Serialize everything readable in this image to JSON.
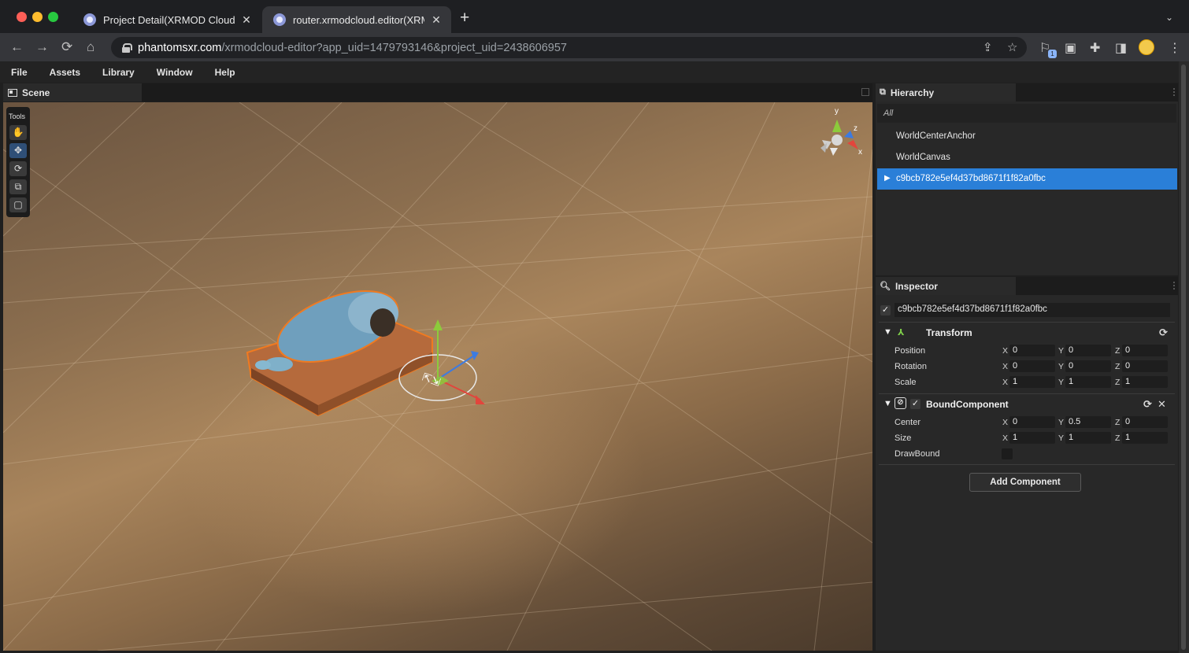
{
  "browser": {
    "tabs": [
      {
        "title": "Project Detail(XRMOD Cloud) -",
        "active": false
      },
      {
        "title": "router.xrmodcloud.editor(XRM",
        "active": true
      }
    ],
    "url_host": "phantomsxr.com",
    "url_path": "/xrmodcloud-editor?app_uid=1479793146&project_uid=2438606957",
    "extension_badge": "1"
  },
  "menu": [
    "File",
    "Assets",
    "Library",
    "Window",
    "Help"
  ],
  "scene": {
    "tab_label": "Scene",
    "tools_label": "Tools",
    "gizmo_labels": {
      "x": "x",
      "y": "y",
      "z": "z"
    },
    "tools": [
      {
        "name": "hand-icon",
        "glyph": "✋",
        "active": false
      },
      {
        "name": "move-icon",
        "glyph": "✥",
        "active": true
      },
      {
        "name": "rotate-icon",
        "glyph": "⟳",
        "active": false
      },
      {
        "name": "scale-icon",
        "glyph": "⧉",
        "active": false
      },
      {
        "name": "rect-icon",
        "glyph": "▢",
        "active": false
      }
    ]
  },
  "hierarchy": {
    "title": "Hierarchy",
    "filter": "All",
    "items": [
      {
        "label": "WorldCenterAnchor",
        "selected": false
      },
      {
        "label": "WorldCanvas",
        "selected": false
      },
      {
        "label": "c9bcb782e5ef4d37bd8671f1f82a0fbc",
        "selected": true
      }
    ]
  },
  "inspector": {
    "title": "Inspector",
    "object_name": "c9bcb782e5ef4d37bd8671f1f82a0fbc",
    "transform": {
      "title": "Transform",
      "rows": [
        {
          "label": "Position",
          "x": "0",
          "y": "0",
          "z": "0"
        },
        {
          "label": "Rotation",
          "x": "0",
          "y": "0",
          "z": "0"
        },
        {
          "label": "Scale",
          "x": "1",
          "y": "1",
          "z": "1"
        }
      ]
    },
    "bound": {
      "title": "BoundComponent",
      "rows": [
        {
          "label": "Center",
          "x": "0",
          "y": "0.5",
          "z": "0"
        },
        {
          "label": "Size",
          "x": "1",
          "y": "1",
          "z": "1"
        }
      ],
      "drawbound_label": "DrawBound"
    },
    "axis_labels": {
      "x": "X",
      "y": "Y",
      "z": "Z"
    },
    "add_component": "Add Component"
  },
  "colors": {
    "selection": "#2a7fd8",
    "gizmo_x": "#e2453c",
    "gizmo_y": "#8ccb3b",
    "gizmo_z": "#3d7be0"
  }
}
